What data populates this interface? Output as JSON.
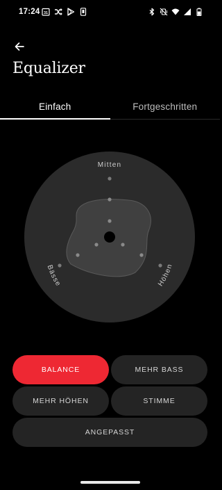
{
  "status_bar": {
    "time": "17:24",
    "notification_icons": [
      "calendar-icon",
      "shuffle-icon",
      "play-store-icon",
      "device-icon"
    ],
    "system_icons": [
      "bluetooth-icon",
      "vibrate-off-icon",
      "wifi-icon",
      "signal-icon",
      "battery-icon"
    ]
  },
  "header": {
    "back_icon": "arrow-left-icon",
    "title": "Equalizer"
  },
  "tabs": [
    {
      "label": "Einfach",
      "active": true
    },
    {
      "label": "Fortgeschritten",
      "active": false
    }
  ],
  "dial": {
    "labels": {
      "mid": "Mitten",
      "bass": "Bässe",
      "treble": "Höhen"
    }
  },
  "presets": [
    {
      "label": "BALANCE",
      "active": true
    },
    {
      "label": "MEHR BASS",
      "active": false
    },
    {
      "label": "MEHR HÖHEN",
      "active": false
    },
    {
      "label": "STIMME",
      "active": false
    },
    {
      "label": "ANGEPASST",
      "active": false
    }
  ],
  "colors": {
    "accent": "#ee2833",
    "background": "#000000",
    "surface": "#242424",
    "dial_bg": "#2b2b2b"
  }
}
